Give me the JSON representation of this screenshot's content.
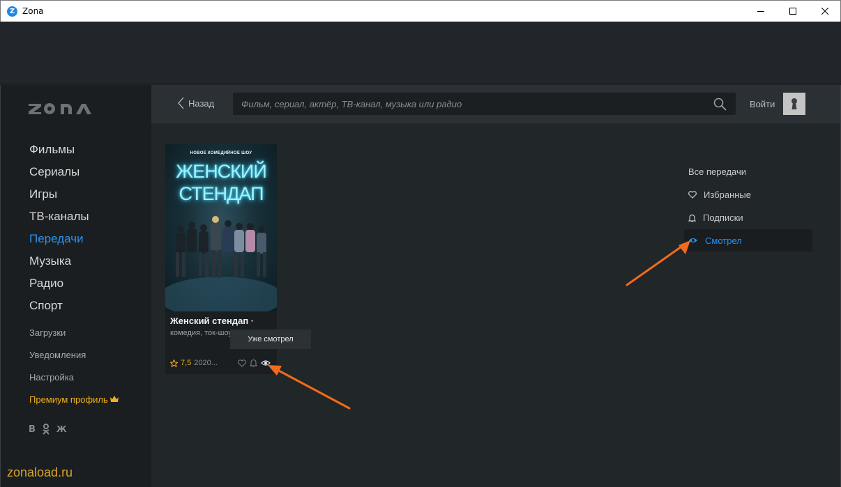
{
  "window": {
    "app_icon_letter": "Z",
    "title": "Zona"
  },
  "sidebar": {
    "main_items": [
      {
        "label": "Фильмы",
        "active": false
      },
      {
        "label": "Сериалы",
        "active": false
      },
      {
        "label": "Игры",
        "active": false
      },
      {
        "label": "ТВ-каналы",
        "active": false
      },
      {
        "label": "Передачи",
        "active": true
      },
      {
        "label": "Музыка",
        "active": false
      },
      {
        "label": "Радио",
        "active": false
      },
      {
        "label": "Спорт",
        "active": false
      }
    ],
    "secondary_items": [
      {
        "label": "Загрузки"
      },
      {
        "label": "Уведомления"
      },
      {
        "label": "Настройка"
      },
      {
        "label": "Премиум профиль"
      }
    ],
    "social": [
      "В",
      "Ok",
      "Ж"
    ]
  },
  "header": {
    "back_label": "Назад",
    "search_placeholder": "Фильм, сериал, актёр, ТВ-канал, музыка или радио",
    "login_label": "Войти"
  },
  "card": {
    "poster_tagline": "НОВОЕ КОМЕДИЙНОЕ ШОУ",
    "poster_title_line1": "ЖЕНСКИЙ",
    "poster_title_line2": "СТЕНДАП",
    "title": "Женский стендап ·",
    "genres": "комедия, ток-шоу",
    "rating": "7,5",
    "year": "2020..."
  },
  "tooltip": "Уже смотрел",
  "filters": [
    {
      "label": "Все передачи",
      "icon": "none",
      "active": false
    },
    {
      "label": "Избранные",
      "icon": "heart-icon",
      "active": false
    },
    {
      "label": "Подписки",
      "icon": "bell-icon",
      "active": false
    },
    {
      "label": "Смотрел",
      "icon": "eye-icon",
      "active": true
    }
  ],
  "watermark": "zonaload.ru",
  "colors": {
    "accent": "#2a93f0",
    "premium": "#f2b01e",
    "annotation": "#f36a1a"
  }
}
